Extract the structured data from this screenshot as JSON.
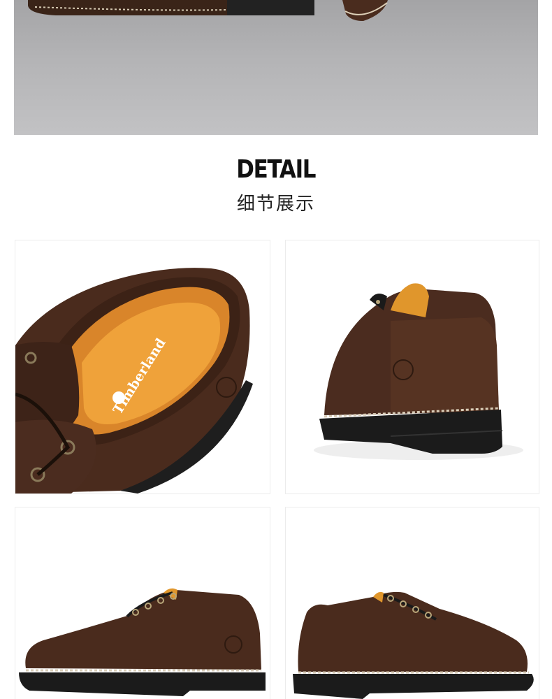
{
  "detail": {
    "title_en": "DETAIL",
    "title_cn": "细节展示"
  },
  "insole": {
    "brand": "Timberland"
  },
  "colors": {
    "leather": "#4a2a1c",
    "leather_dark": "#2e1a12",
    "lining": "#e59a2c",
    "sole": "#1c1c1c",
    "stitch": "#d9cdb8"
  }
}
